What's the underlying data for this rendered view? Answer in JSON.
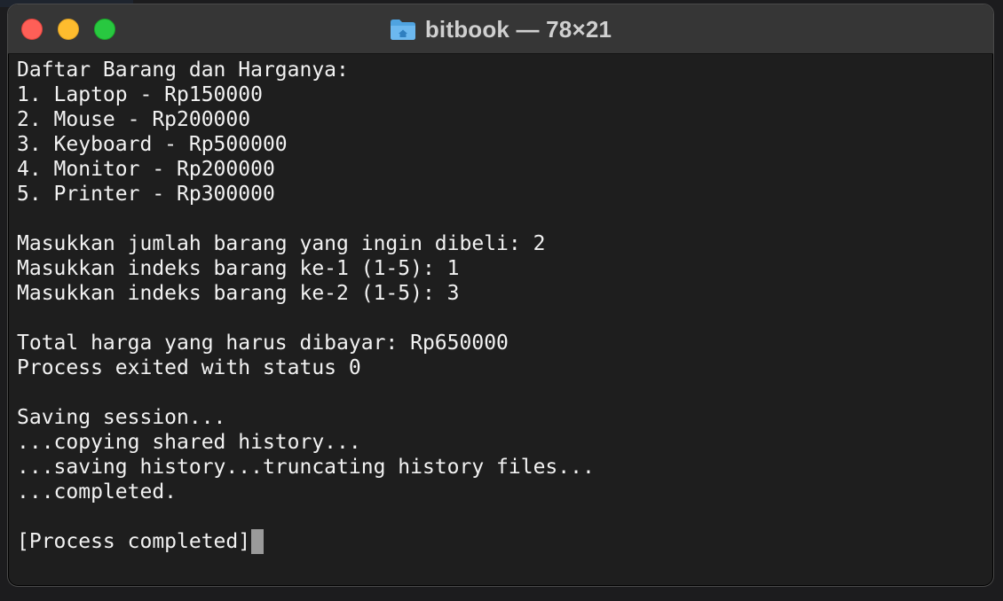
{
  "window": {
    "title": "bitbook — 78×21",
    "title_icon": "home-folder-icon"
  },
  "colors": {
    "background": "#1e1e1e",
    "text": "#f2f2f2",
    "cursor": "#9a9a9a",
    "close": "#ff5f57",
    "minimize": "#febc2e",
    "maximize": "#28c840"
  },
  "terminal": {
    "lines": [
      "Daftar Barang dan Harganya:",
      "1. Laptop - Rp150000",
      "2. Mouse - Rp200000",
      "3. Keyboard - Rp500000",
      "4. Monitor - Rp200000",
      "5. Printer - Rp300000",
      "",
      "Masukkan jumlah barang yang ingin dibeli: 2",
      "Masukkan indeks barang ke-1 (1-5): 1",
      "Masukkan indeks barang ke-2 (1-5): 3",
      "",
      "Total harga yang harus dibayar: Rp650000",
      "Process exited with status 0",
      "",
      "Saving session...",
      "...copying shared history...",
      "...saving history...truncating history files...",
      "...completed.",
      "",
      "[Process completed]"
    ]
  }
}
